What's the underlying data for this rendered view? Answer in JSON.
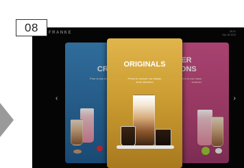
{
  "step_badge": "08",
  "screen": {
    "brand": "FRANKE",
    "status_lines": [
      "08:21",
      "Sep 18 2023"
    ],
    "nav": {
      "prev_icon": "chevron-left-icon",
      "next_icon": "chevron-right-icon",
      "prev_glyph": "‹",
      "next_glyph": "›"
    },
    "cards": {
      "left": {
        "title_lines": [
          "COL",
          "CREAT"
        ],
        "subtitle": "Pour la soy bar ( mocafsh"
      },
      "center": {
        "title": "ORIGINALS",
        "subtitle": "Press to explore our classic drink selection"
      },
      "right": {
        "title_lines": [
          "MMER",
          "ATIONS"
        ],
        "subtitle": "m aurpers to our mess summer"
      }
    }
  },
  "colors": {
    "screen_bg": "#050505",
    "card_blue": "#3b87c1",
    "card_gold": "#e0b54b",
    "card_pink": "#d2528b"
  }
}
